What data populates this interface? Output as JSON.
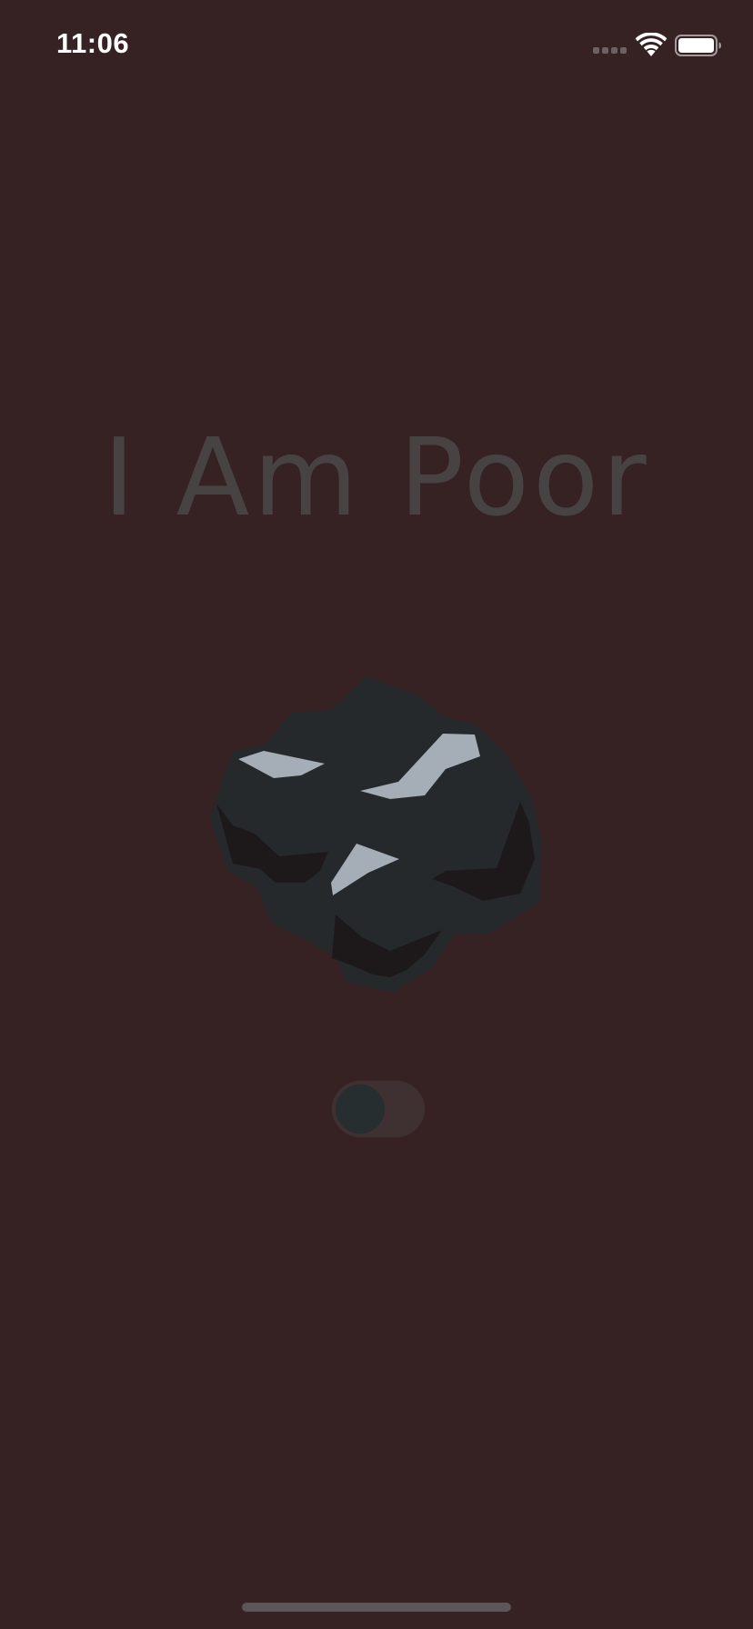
{
  "status_bar": {
    "time": "11:06",
    "signal_icon": "cellular-signal-icon",
    "wifi_icon": "wifi-icon",
    "battery_icon": "battery-icon"
  },
  "main": {
    "title": "I Am Poor",
    "image_icon": "coal-icon",
    "toggle": {
      "state": "off"
    }
  },
  "colors": {
    "background": "#362123",
    "title_text": "#474343",
    "coal_body": "#25292c",
    "coal_highlight": "#a5aeb7",
    "coal_shadow": "#1d191a",
    "toggle_track": "#3f3032",
    "toggle_knob": "#272e30"
  }
}
